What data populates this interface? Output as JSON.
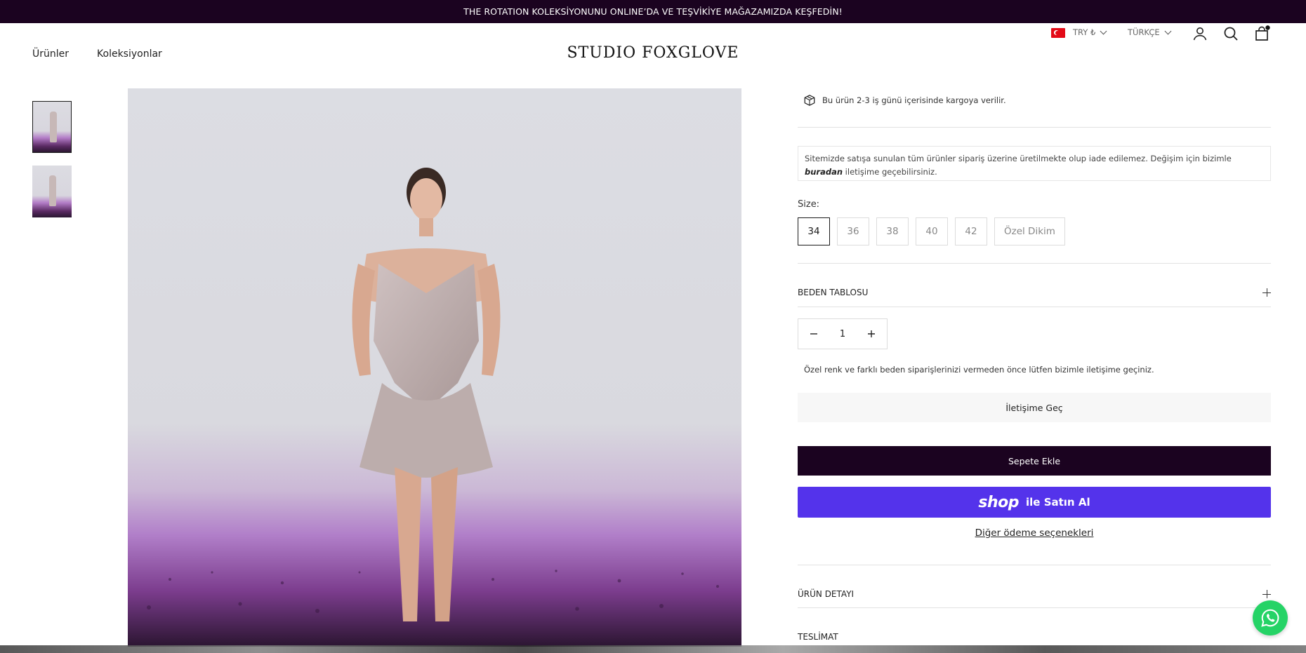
{
  "announcement": "THE ROTATION KOLEKSİYONUNU ONLINE’DA VE TEŞVİKİYE MAĞAZAMIZDA KEŞFEDİN!",
  "header": {
    "nav": [
      {
        "label": "Ürünler"
      },
      {
        "label": "Koleksiyonlar"
      }
    ],
    "logo": "STUDIO FOXGLOVE",
    "currency": "TRY ₺",
    "language": "TÜRKÇE",
    "icons": [
      "account-icon",
      "search-icon",
      "cart-icon"
    ]
  },
  "gallery": {
    "thumbnails": 2,
    "selected_index": 0
  },
  "product": {
    "shipping_note": "Bu ürün 2-3 iş günü içerisinde kargoya verilir.",
    "return_notice_pre": "Sitemizde satışa sunulan tüm ürünler sipariş üzerine üretilmekte olup iade edilemez. Değişim için bizimle ",
    "return_notice_link": "buradan",
    "return_notice_post": " iletişime geçebilirsiniz.",
    "size_label": "Size:",
    "sizes": [
      "34",
      "36",
      "38",
      "40",
      "42",
      "Özel Dikim"
    ],
    "selected_size": "34",
    "size_chart": "BEDEN TABLOSU",
    "quantity": "1",
    "custom_note": "Özel renk ve farklı beden siparişlerinizi vermeden önce lütfen bizimle iletişime geçiniz.",
    "contact_button": "İletişime Geç",
    "add_to_cart": "Sepete Ekle",
    "shop_pay_logo": "shop",
    "shop_pay_text": "ile Satın Al",
    "more_payment": "Diğer ödeme seçenekleri",
    "accordions": [
      "ÜRÜN DETAYI",
      "TESLİMAT"
    ]
  },
  "colors": {
    "brand_dark": "#1b0320",
    "shop_pay": "#5433eb",
    "whatsapp": "#25d366"
  }
}
